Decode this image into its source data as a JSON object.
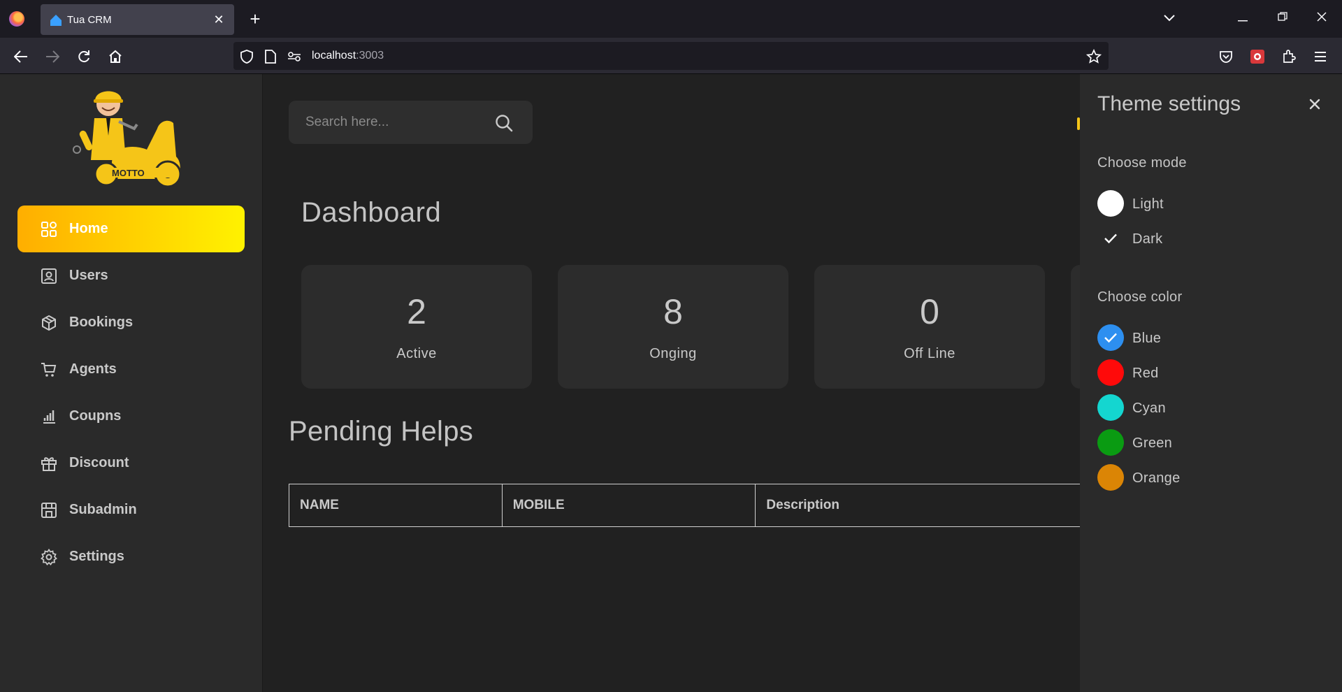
{
  "browser": {
    "tab_title": "Tua CRM",
    "url_host": "localhost",
    "url_port": ":3003"
  },
  "sidebar": {
    "items": [
      {
        "label": "Home",
        "icon": "grid-icon",
        "active": true
      },
      {
        "label": "Users",
        "icon": "user-card-icon",
        "active": false
      },
      {
        "label": "Bookings",
        "icon": "box-icon",
        "active": false
      },
      {
        "label": "Agents",
        "icon": "cart-icon",
        "active": false
      },
      {
        "label": "Coupns",
        "icon": "bar-chart-icon",
        "active": false
      },
      {
        "label": "Discount",
        "icon": "gift-icon",
        "active": false
      },
      {
        "label": "Subadmin",
        "icon": "store-icon",
        "active": false
      },
      {
        "label": "Settings",
        "icon": "gear-icon",
        "active": false
      }
    ]
  },
  "search": {
    "placeholder": "Search here..."
  },
  "dashboard": {
    "title": "Dashboard",
    "stats": [
      {
        "value": "2",
        "label": "Active"
      },
      {
        "value": "8",
        "label": "Onging"
      },
      {
        "value": "0",
        "label": "Off Line"
      }
    ]
  },
  "pending": {
    "title": "Pending Helps",
    "columns": [
      "NAME",
      "MOBILE",
      "Description"
    ]
  },
  "theme": {
    "title": "Theme settings",
    "mode_label": "Choose mode",
    "modes": [
      {
        "label": "Light",
        "selected": false
      },
      {
        "label": "Dark",
        "selected": true
      }
    ],
    "color_label": "Choose color",
    "colors": [
      {
        "label": "Blue",
        "hex": "#2d8ff0",
        "selected": true
      },
      {
        "label": "Red",
        "hex": "#ff0a0a",
        "selected": false
      },
      {
        "label": "Cyan",
        "hex": "#14d6d0",
        "selected": false
      },
      {
        "label": "Green",
        "hex": "#0a9b12",
        "selected": false
      },
      {
        "label": "Orange",
        "hex": "#db8505",
        "selected": false
      }
    ]
  },
  "colors": {
    "accent_gradient_start": "#ffae00",
    "accent_gradient_end": "#fff200"
  }
}
